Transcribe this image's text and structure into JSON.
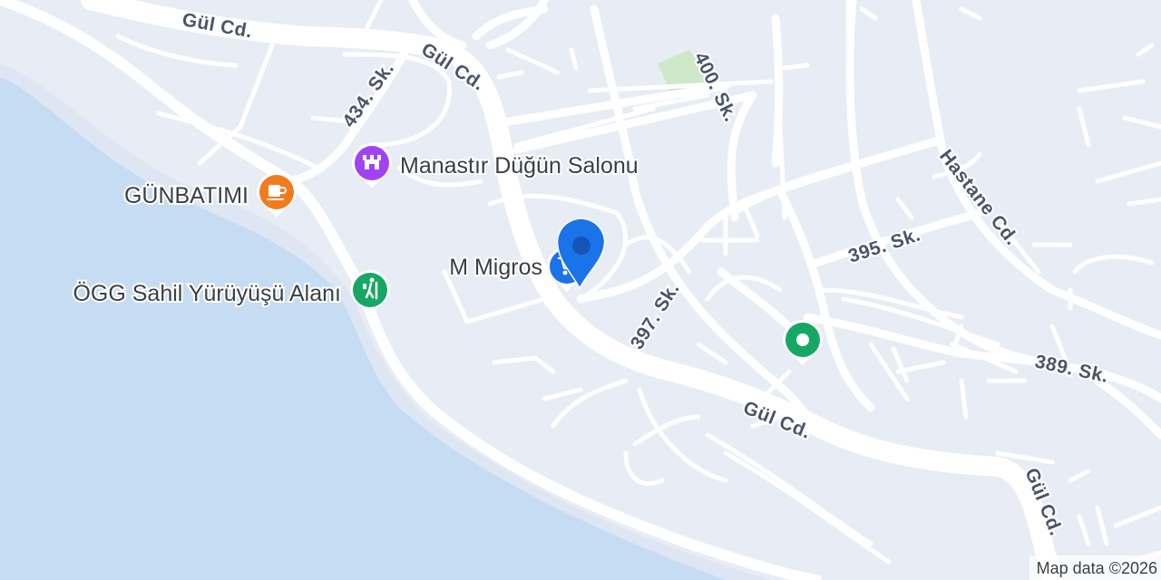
{
  "map": {
    "roads": [
      {
        "name": "Gül Cd.",
        "label_id": "gul-cd-1"
      },
      {
        "name": "Gül Cd.",
        "label_id": "gul-cd-2"
      },
      {
        "name": "Gül Cd.",
        "label_id": "gul-cd-3"
      },
      {
        "name": "Gül Cd.",
        "label_id": "gul-cd-4"
      },
      {
        "name": "434. Sk.",
        "label_id": "sk-434"
      },
      {
        "name": "400. Sk.",
        "label_id": "sk-400"
      },
      {
        "name": "Hastane Cd.",
        "label_id": "hastane-cd"
      },
      {
        "name": "395. Sk.",
        "label_id": "sk-395"
      },
      {
        "name": "397. Sk.",
        "label_id": "sk-397"
      },
      {
        "name": "389. Sk.",
        "label_id": "sk-389"
      }
    ],
    "pois": [
      {
        "name": "Manastır Düğün Salonu",
        "category": "wedding-venue",
        "icon": "castle-icon",
        "color": "#a142f4"
      },
      {
        "name": "GÜNBATIMI",
        "category": "cafe",
        "icon": "coffee-cup-icon",
        "color": "#f07c1e"
      },
      {
        "name": "M Migros",
        "category": "supermarket",
        "icon": "shopping-cart-icon",
        "color": "#1a73e8"
      },
      {
        "name": "ÖGG Sahil Yürüyüşü Alanı",
        "category": "park",
        "icon": "hiker-icon",
        "color": "#16a765"
      },
      {
        "name": "",
        "category": "place",
        "icon": "dot-icon",
        "color": "#16a765"
      }
    ],
    "selected_marker": {
      "icon": "location-pin-icon",
      "color": "#1a73e8"
    },
    "colors": {
      "land": "#e8ecf4",
      "water": "#c6dcf2",
      "road": "#ffffff",
      "park": "#cfe8c8"
    },
    "attribution": "Map data ©2026"
  }
}
